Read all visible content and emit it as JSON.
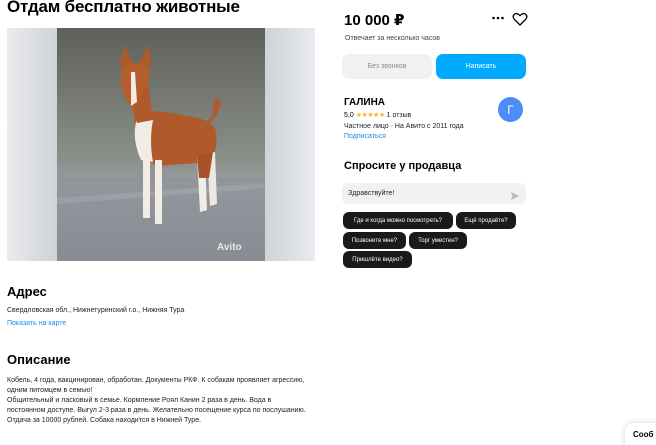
{
  "listing": {
    "title": "Отдам бесплатно животные",
    "price": "10 000 ₽",
    "posted": "Отвечает за несколько часов",
    "photo_watermark": "Avito",
    "icons": {
      "more": "more-dots-icon",
      "favorite": "heart-icon",
      "send": "send-icon"
    }
  },
  "actions": {
    "no_calls_label": "Без звонков",
    "write_label": "Написать"
  },
  "seller": {
    "name": "ГАЛИНА",
    "rating": "5,0",
    "stars": "★★★★★",
    "reviews": "1 отзыв",
    "since": "Частное лицо · На Авито с 2011 года",
    "subscribe": "Подписаться",
    "avatar_letter": "Г",
    "avatar_color": "#4e8cf8"
  },
  "ask": {
    "heading": "Спросите у продавца",
    "input_value": "Здравствуйте!",
    "chips": [
      "Где и когда можно посмотреть?",
      "Ещё продаёте?",
      "Позвоните мне?",
      "Торг уместен?",
      "Пришлёте видео?"
    ]
  },
  "address": {
    "heading": "Адрес",
    "text": "Свердловская обл., Нижнетуринский г.о., Нижняя Тура",
    "map_link": "Показать на карте"
  },
  "description": {
    "heading": "Описание",
    "lines": [
      "Кобель, 4 года, вакцинирован, обработан. Документы РКФ. К собакам проявляет агрессию, одним питомцем в семью!",
      "Общительный и ласковый в семье. Кормление Роял Канин 2 раза в день. Вода в постоянном доступе. Выгул 2-3 раза в день. Желательно посещение курса по послушанию.",
      "Отдача за 10000 рублей. Собака находится в Нижней Туре."
    ]
  },
  "messenger_tab": "Сооб",
  "colors": {
    "accent": "#00aaff",
    "link": "#1a8ae8",
    "star": "#ffb021"
  }
}
